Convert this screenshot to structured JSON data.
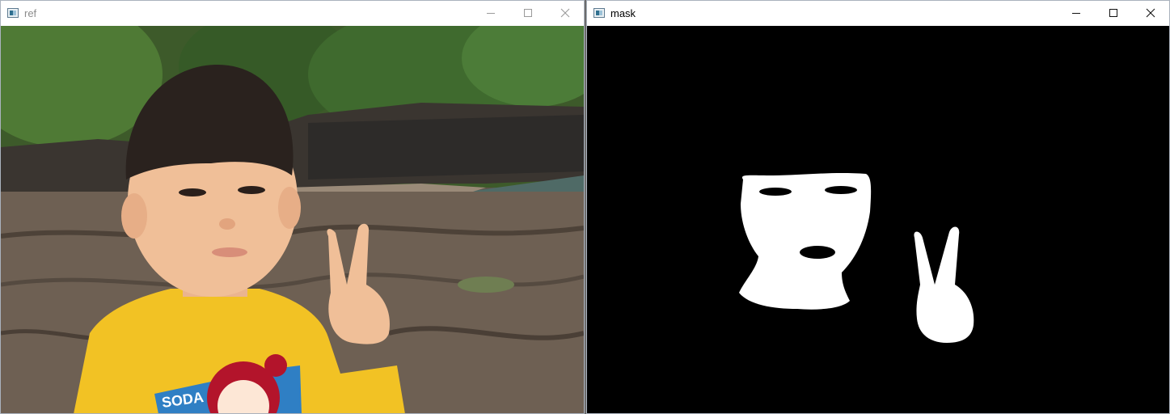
{
  "windows": {
    "ref": {
      "title": "ref",
      "image": {
        "description_icon": "photo-icon",
        "shirt_text": "SODA"
      }
    },
    "mask": {
      "title": "mask"
    }
  },
  "colors": {
    "mask_background": "#000000",
    "mask_foreground": "#ffffff",
    "shirt_yellow": "#f2c224"
  }
}
